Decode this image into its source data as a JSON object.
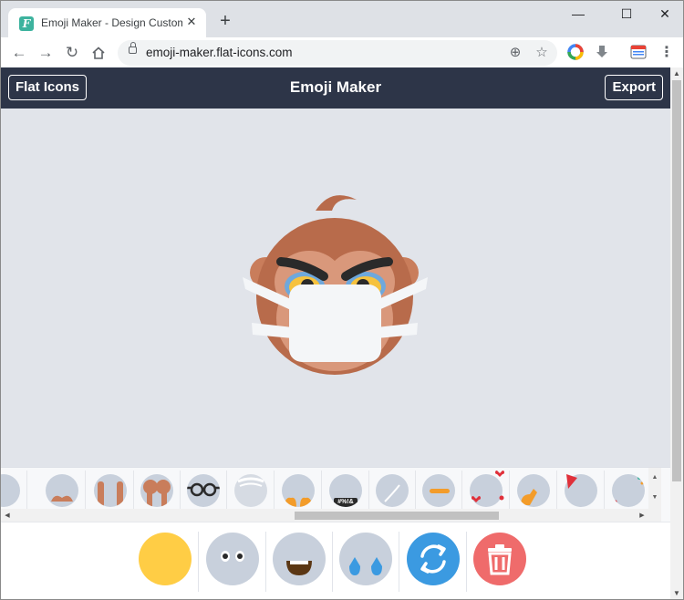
{
  "browser": {
    "tab_title": "Emoji Maker - Design Custom E",
    "favicon_letter": "F",
    "new_tab_label": "+",
    "url": "emoji-maker.flat-icons.com",
    "window_controls": [
      "—",
      "☐",
      "✕"
    ]
  },
  "app": {
    "left_button": "Flat Icons",
    "title": "Emoji Maker",
    "right_button": "Export"
  },
  "parts": {
    "label_text": "#%!&"
  },
  "colors": {
    "header_bg": "#2d3548",
    "canvas_bg": "#e1e4ea",
    "skin_yellow": "#ffcd45",
    "refresh_blue": "#3b9ae1",
    "delete_red": "#ef6b6b",
    "monkey_fur": "#b86b4b",
    "monkey_face": "#d9987b"
  }
}
